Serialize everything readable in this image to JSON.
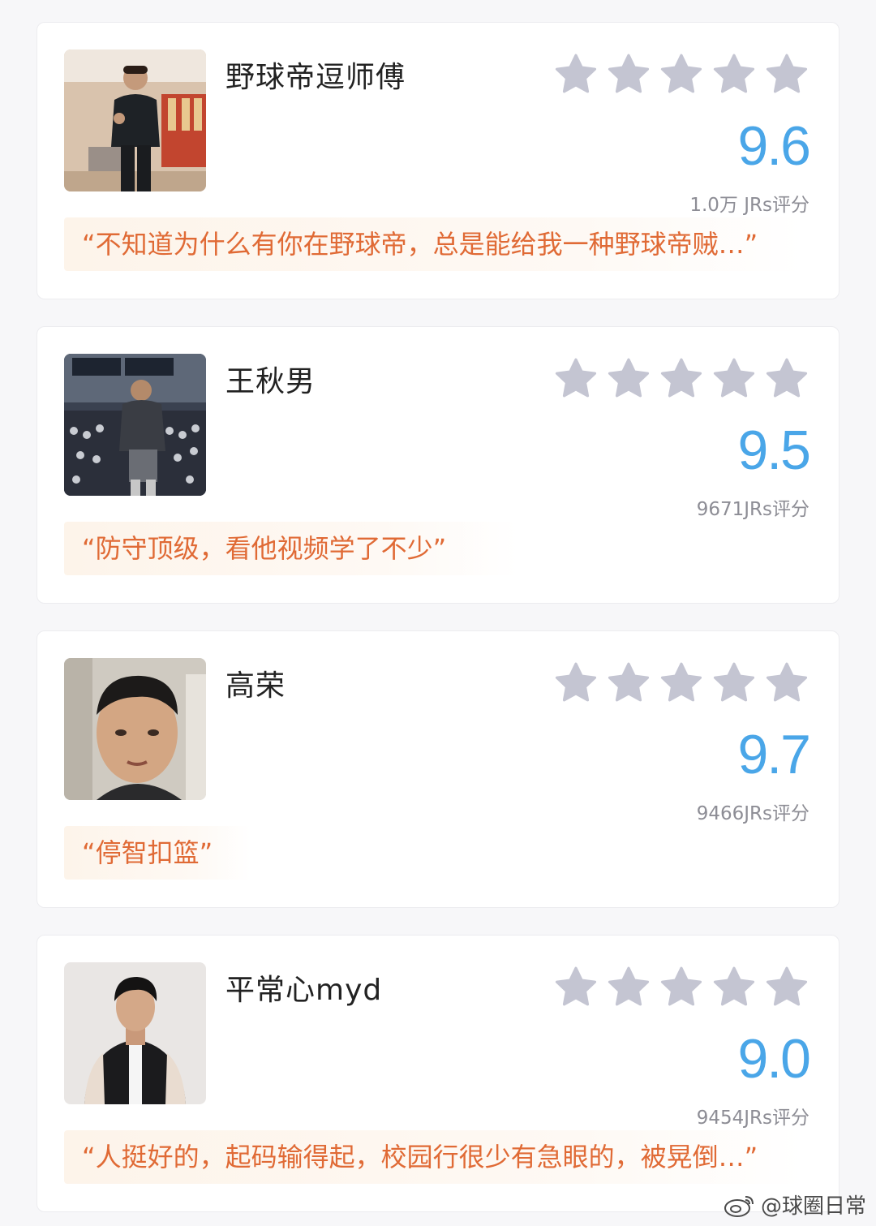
{
  "colors": {
    "score": "#4aa6e8",
    "quote_text": "#e06a35",
    "quote_bg": "#fdf4ea",
    "star": "#c4c5d2"
  },
  "cards": [
    {
      "name": "野球帝逗师傅",
      "stars": 5,
      "score": "9.6",
      "count": "1.0万 JRs评分",
      "quote": "“不知道为什么有你在野球帝，总是能给我一种野球帝贼…”",
      "avatar_icon": "person-in-gym-photo"
    },
    {
      "name": "王秋男",
      "stars": 5,
      "score": "9.5",
      "count": "9671JRs评分",
      "quote": "“防守顶级，看他视频学了不少”",
      "avatar_icon": "player-on-court-photo"
    },
    {
      "name": "高荣",
      "stars": 5,
      "score": "9.7",
      "count": "9466JRs评分",
      "quote": "“停智扣篮”",
      "avatar_icon": "face-portrait-photo"
    },
    {
      "name": "平常心myd",
      "stars": 5,
      "score": "9.0",
      "count": "9454JRs评分",
      "quote": "“人挺好的，起码输得起，校园行很少有急眼的，被晃倒…”",
      "avatar_icon": "person-in-jacket-photo"
    }
  ],
  "watermark": {
    "text": "@球圈日常",
    "icon": "weibo-icon"
  }
}
